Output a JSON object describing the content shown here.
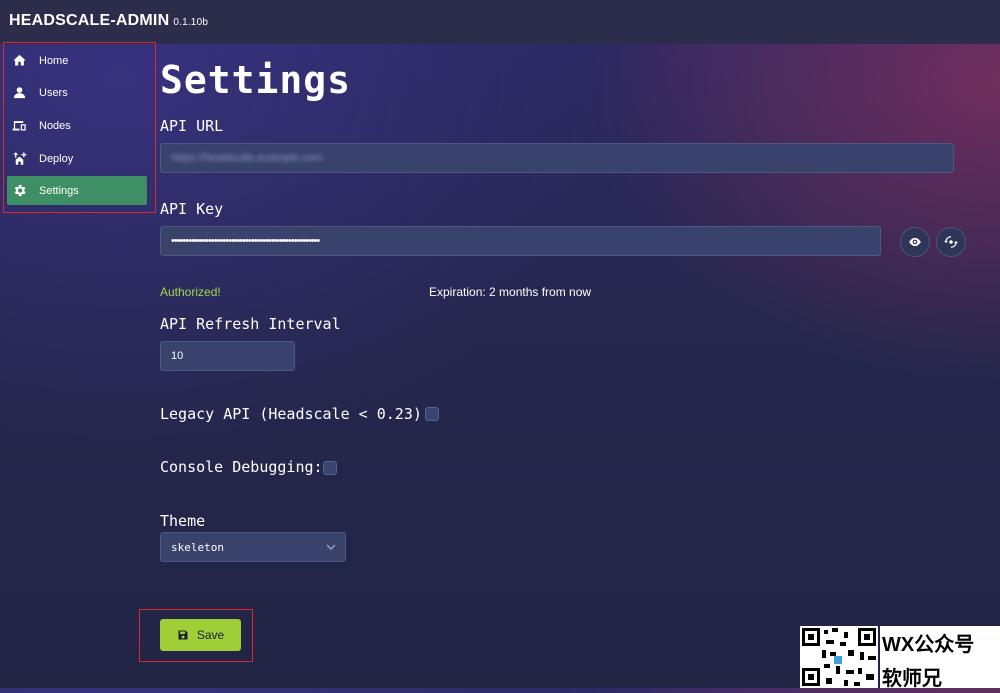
{
  "app": {
    "name": "HEADSCALE-ADMIN",
    "version": "0.1.10b"
  },
  "sidebar": {
    "items": [
      {
        "label": "Home",
        "icon": "home-icon"
      },
      {
        "label": "Users",
        "icon": "user-icon"
      },
      {
        "label": "Nodes",
        "icon": "devices-icon"
      },
      {
        "label": "Deploy",
        "icon": "deploy-icon"
      },
      {
        "label": "Settings",
        "icon": "gear-icon",
        "active": true
      }
    ]
  },
  "main": {
    "title": "Settings",
    "api_url": {
      "label": "API URL",
      "value": "https://headscale.example.com"
    },
    "api_key": {
      "label": "API Key",
      "value": "••••••••••••••••••••••••••••••••••••••••••••••••••••",
      "show_icon": "eye-icon",
      "refresh_icon": "refresh-icon"
    },
    "status": {
      "authorized": "Authorized!",
      "expiration": "Expiration: 2 months from now"
    },
    "refresh_interval": {
      "label": "API Refresh Interval",
      "value": "10"
    },
    "legacy_api": {
      "label": "Legacy API (Headscale < 0.23):",
      "checked": false
    },
    "console_debugging": {
      "label": "Console Debugging:",
      "checked": false
    },
    "theme": {
      "label": "Theme",
      "selected": "skeleton"
    },
    "save_button": {
      "label": "Save",
      "icon": "save-icon"
    }
  },
  "watermark": {
    "line1": "WX公众号",
    "line2": "软师兄"
  },
  "colors": {
    "accent_active": "#3f8f66",
    "save": "#9fce36",
    "authorized": "#a3d64e",
    "highlight_box": "#e0252b"
  }
}
